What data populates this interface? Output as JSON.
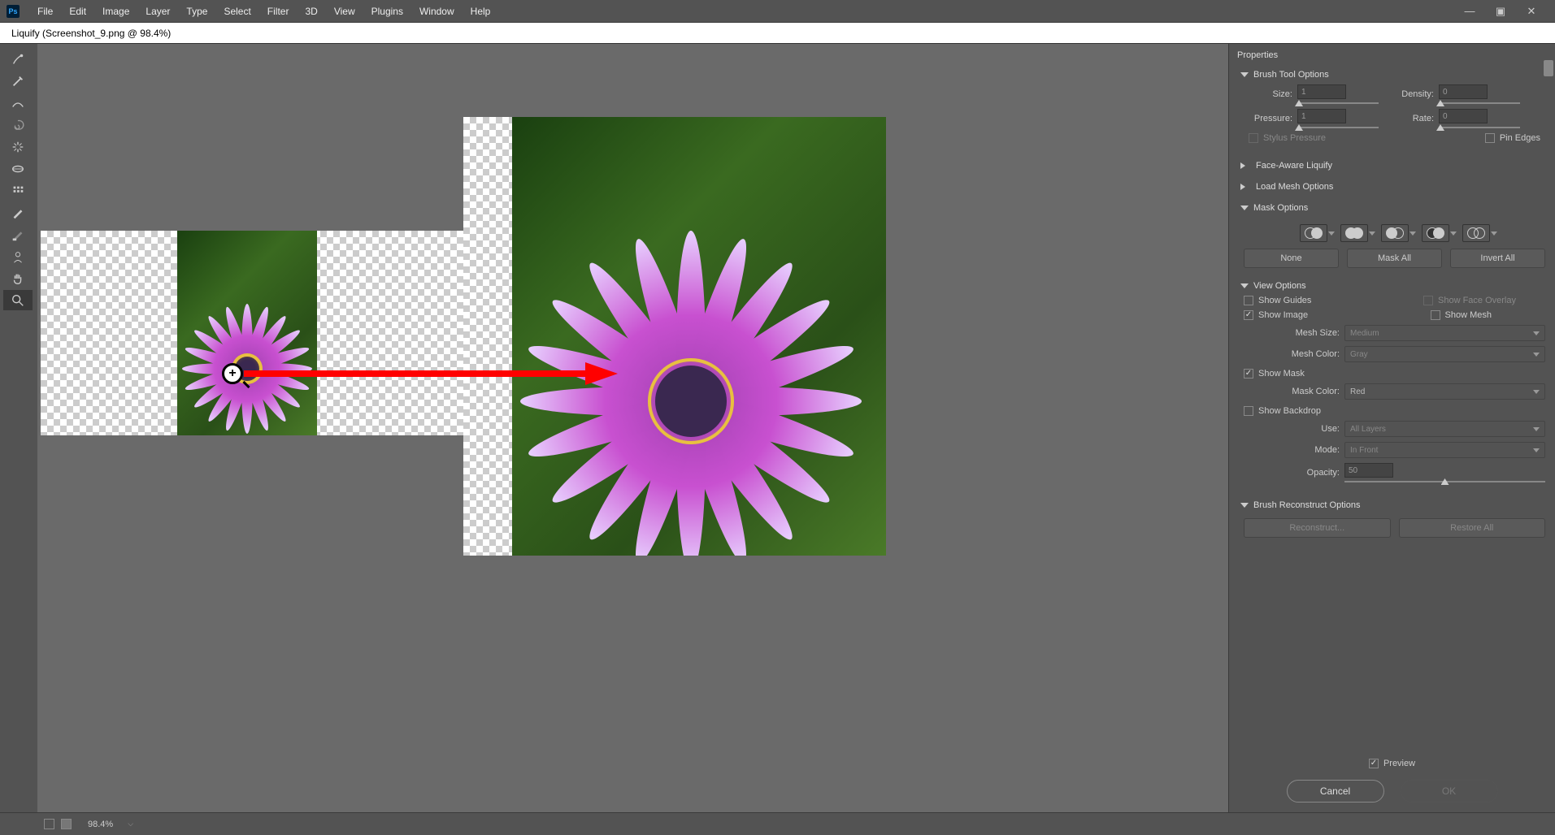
{
  "menu": [
    "File",
    "Edit",
    "Image",
    "Layer",
    "Type",
    "Select",
    "Filter",
    "3D",
    "View",
    "Plugins",
    "Window",
    "Help"
  ],
  "dialog_title": "Liquify (Screenshot_9.png @ 98.4%)",
  "props": {
    "title": "Properties"
  },
  "brush": {
    "head": "Brush Tool Options",
    "size_label": "Size:",
    "size": "1",
    "density_label": "Density:",
    "density": "0",
    "pressure_label": "Pressure:",
    "pressure": "1",
    "rate_label": "Rate:",
    "rate": "0",
    "stylus": "Stylus Pressure",
    "pin_edges": "Pin Edges"
  },
  "face_aware": "Face-Aware Liquify",
  "load_mesh": "Load Mesh Options",
  "mask": {
    "head": "Mask Options",
    "none": "None",
    "mask_all": "Mask All",
    "invert_all": "Invert All"
  },
  "view": {
    "head": "View Options",
    "show_guides": "Show Guides",
    "show_face": "Show Face Overlay",
    "show_image": "Show Image",
    "show_mesh": "Show Mesh",
    "mesh_size_label": "Mesh Size:",
    "mesh_size": "Medium",
    "mesh_color_label": "Mesh Color:",
    "mesh_color": "Gray",
    "show_mask": "Show Mask",
    "mask_color_label": "Mask Color:",
    "mask_color": "Red",
    "show_backdrop": "Show Backdrop",
    "use_label": "Use:",
    "use": "All Layers",
    "mode_label": "Mode:",
    "mode": "In Front",
    "opacity_label": "Opacity:",
    "opacity": "50"
  },
  "brush_recon": {
    "head": "Brush Reconstruct Options",
    "reconstruct": "Reconstruct...",
    "restore": "Restore All"
  },
  "preview": "Preview",
  "cancel": "Cancel",
  "ok": "OK",
  "zoom": "98.4%"
}
